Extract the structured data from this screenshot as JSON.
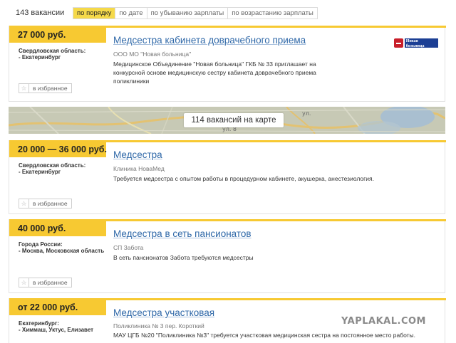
{
  "header": {
    "count": "143 вакансии",
    "sort_options": [
      "по порядку",
      "по дате",
      "по убыванию зарплаты",
      "по возрастанию зарплаты"
    ],
    "active_sort": 0
  },
  "map": {
    "label": "114 вакансий на карте",
    "street_label": "ул.",
    "street_label_2": "ул. 8"
  },
  "favorite_label": "в избранное",
  "vacancies": [
    {
      "salary": "27 000 руб.",
      "region": "Свердловская область:",
      "city": "- Екатеринбург",
      "title": "Медсестра кабинета доврачебного приема",
      "employer": "ООО МО \"Новая больница\"",
      "description": "Медицинское Объединение \"Новая больница\" ГКБ № 33 приглашает на конкурсной основе медицинскую сестру кабинета доврачебного приема поликлиники",
      "logo_text": "Новая больница"
    },
    {
      "salary": "20 000 — 36 000 руб.",
      "region": "Свердловская область:",
      "city": "- Екатеринбург",
      "title": "Медсестра",
      "employer": "Клиника НоваМед",
      "description": "Требуется медсестра с опытом работы в процедурном кабинете, акушерка, анестезиология."
    },
    {
      "salary": "40 000 руб.",
      "region": "Города России:",
      "city": "- Москва, Московская область",
      "title": "Медсестра в сеть пансионатов",
      "employer": "СП Забота",
      "description": "В сеть пансионатов Забота требуются медсестры"
    },
    {
      "salary": "от 22 000 руб.",
      "region": "Екатеринбург:",
      "city": "- Химмаш, Уктус, Елизавет",
      "title": "Медсестра участковая",
      "employer": "Поликлиника № 3 пер. Короткий",
      "description": "МАУ ЦГБ №20 \"Поликлиника №3\" требуется участковая медицинская сестра на постоянное место работы."
    }
  ],
  "watermark": "YAPLAKAL.COM",
  "colors": {
    "accent": "#f7c932",
    "link": "#2f68a8"
  }
}
